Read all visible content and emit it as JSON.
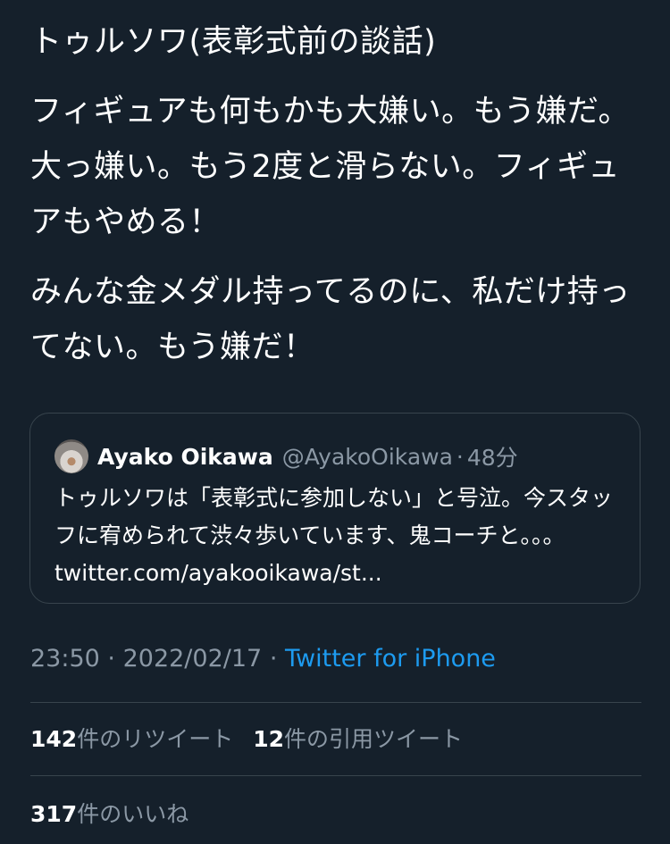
{
  "tweet": {
    "paragraph1": "トゥルソワ(表彰式前の談話)",
    "paragraph2": "フィギュアも何もかも大嫌い。もう嫌だ。大っ嫌い。もう2度と滑らない。フィギュアもやめる！",
    "paragraph3": "みんな金メダル持ってるのに、私だけ持ってない。もう嫌だ！"
  },
  "quote": {
    "avatar_icon": "avatar-photo",
    "name": "Ayako Oikawa",
    "handle": "@AyakoOikawa",
    "separator": "·",
    "time": "48分",
    "body": "トゥルソワは「表彰式に参加しない」と号泣。今スタッフに宥められて渋々歩いています、鬼コーチと。。。 twitter.com/ayakooikawa/st..."
  },
  "meta": {
    "time": "23:50",
    "separator1": "·",
    "date": "2022/02/17",
    "separator2": "·",
    "source": "Twitter for iPhone"
  },
  "stats": {
    "retweets_count": "142",
    "retweets_label": "件のリツイート",
    "quotes_count": "12",
    "quotes_label": "件の引用ツイート",
    "likes_count": "317",
    "likes_label": "件のいいね"
  },
  "colors": {
    "background": "#15202b",
    "text": "#ffffff",
    "muted": "#8b98a5",
    "link": "#1d9bf0",
    "border": "#38444d"
  }
}
